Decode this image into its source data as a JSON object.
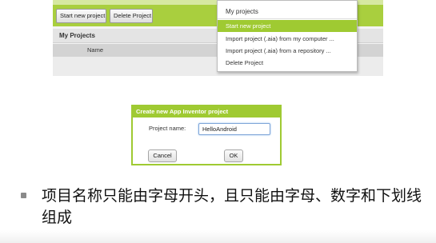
{
  "app": {
    "toolbar": {
      "start_new_project": "Start new project",
      "delete_project": "Delete Project"
    },
    "panel_title": "My Projects",
    "column_name": "Name",
    "menu": {
      "title": "My projects",
      "items": [
        {
          "label": "Start new project",
          "selected": true
        },
        {
          "label": "Import project (.aia) from my computer ...",
          "selected": false
        },
        {
          "label": "Import project (.aia) from a repository ...",
          "selected": false
        },
        {
          "label": "Delete Project",
          "selected": false
        }
      ]
    },
    "accent_color": "#9fca32"
  },
  "dialog": {
    "title": "Create new App Inventor project",
    "project_name_label": "Project name:",
    "project_name_value": "HelloAndroid",
    "cancel_label": "Cancel",
    "ok_label": "OK"
  },
  "note": {
    "text": "项目名称只能由字母开头，且只能由字母、数字和下划线组成"
  }
}
